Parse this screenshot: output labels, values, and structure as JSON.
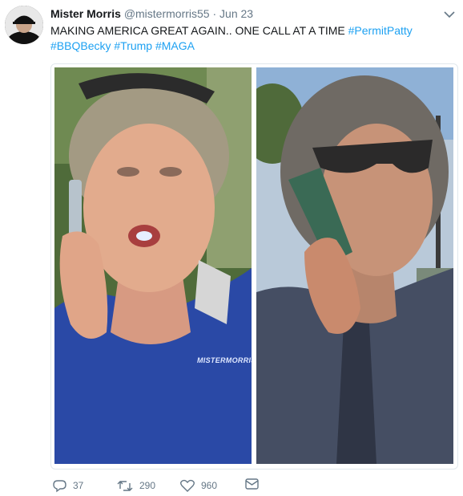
{
  "tweet": {
    "display_name": "Mister Morris",
    "handle": "@mistermorris55",
    "separator": "·",
    "date": "Jun 23",
    "text_main": "MAKING AMERICA GREAT AGAIN.. ONE CALL AT A TIME",
    "hashtags": [
      "#PermitPatty",
      "#BBQBecky",
      "#Trump",
      "#MAGA"
    ]
  },
  "media": {
    "watermark": "MISTERMORRIS"
  },
  "actions": {
    "replies": "37",
    "retweets": "290",
    "likes": "960"
  },
  "icons": [
    "avatar",
    "chevron-down-icon",
    "reply-icon",
    "retweet-icon",
    "like-icon",
    "message-icon"
  ],
  "colors": {
    "link": "#1da1f2",
    "meta": "#657786",
    "text": "#14171a"
  }
}
